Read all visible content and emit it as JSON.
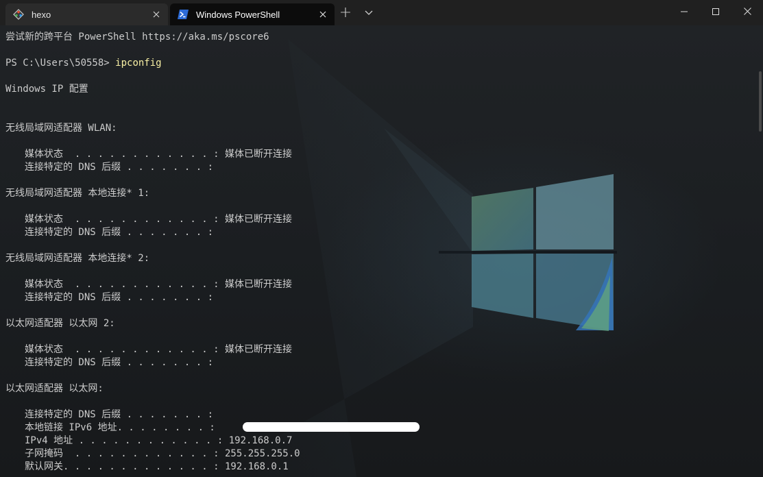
{
  "titlebar": {
    "tabs": [
      {
        "title": "hexo",
        "icon": "git-diamond-icon",
        "active": false
      },
      {
        "title": "Windows PowerShell",
        "icon": "powershell-icon",
        "active": true
      }
    ],
    "new_tab_symbol": "+",
    "dropdown_icon": "chevron-down-icon",
    "window_controls": [
      "minimize-icon",
      "maximize-icon",
      "close-icon"
    ]
  },
  "terminal": {
    "banner": "尝试新的跨平台 PowerShell https://aka.ms/pscore6",
    "prompt": "PS C:\\Users\\50558> ",
    "command": "ipconfig",
    "header": "Windows IP 配置",
    "adapters": [
      {
        "name": "无线局域网适配器 WLAN:",
        "rows": [
          "媒体状态  . . . . . . . . . . . . : 媒体已断开连接",
          "连接特定的 DNS 后缀 . . . . . . . :"
        ]
      },
      {
        "name": "无线局域网适配器 本地连接* 1:",
        "rows": [
          "媒体状态  . . . . . . . . . . . . : 媒体已断开连接",
          "连接特定的 DNS 后缀 . . . . . . . :"
        ]
      },
      {
        "name": "无线局域网适配器 本地连接* 2:",
        "rows": [
          "媒体状态  . . . . . . . . . . . . : 媒体已断开连接",
          "连接特定的 DNS 后缀 . . . . . . . :"
        ]
      },
      {
        "name": "以太网适配器 以太网 2:",
        "rows": [
          "媒体状态  . . . . . . . . . . . . : 媒体已断开连接",
          "连接特定的 DNS 后缀 . . . . . . . :"
        ]
      },
      {
        "name": "以太网适配器 以太网:",
        "rows": [
          "连接特定的 DNS 后缀 . . . . . . . :",
          "本地链接 IPv6 地址. . . . . . . . :",
          "IPv4 地址 . . . . . . . . . . . . : 192.168.0.7",
          "子网掩码  . . . . . . . . . . . . : 255.255.255.0",
          "默认网关. . . . . . . . . . . . . : 192.168.0.1"
        ]
      }
    ]
  },
  "colors": {
    "titlebar_bg": "#202020",
    "active_tab_bg": "#0c0c0c",
    "terminal_text": "#cccccc",
    "command_text": "#f9f1a5",
    "redaction": "#ffffff"
  }
}
